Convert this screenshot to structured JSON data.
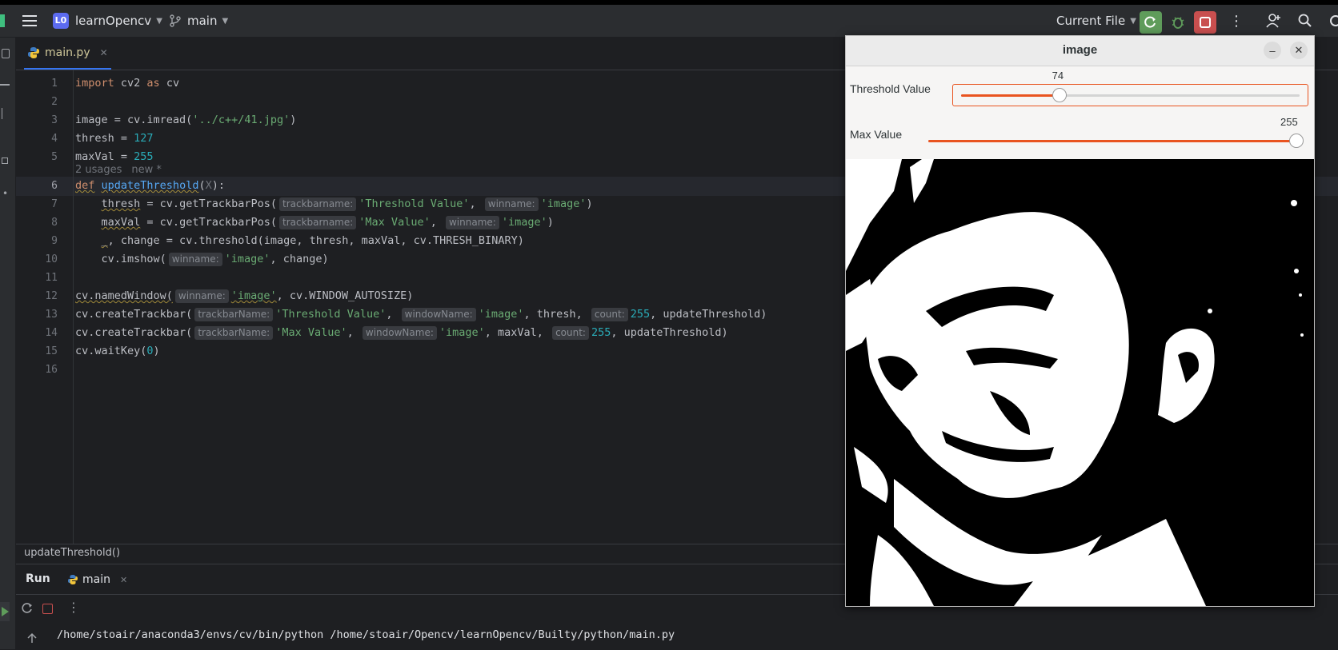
{
  "toolbar": {
    "project_badge": "L0",
    "project_name": "learnOpencv",
    "branch": "main",
    "run_config": "Current File"
  },
  "editor": {
    "tab_label": "main.py",
    "usage_hint": "2 usages",
    "usage_new": "new *",
    "line_numbers": [
      "1",
      "2",
      "3",
      "4",
      "5",
      "6",
      "7",
      "8",
      "9",
      "10",
      "11",
      "12",
      "13",
      "14",
      "15",
      "16"
    ],
    "lines": {
      "l1_import": "import",
      "l1_mod": " cv2 ",
      "l1_as": "as",
      "l1_alias": " cv",
      "l3_a": "image = cv.imread(",
      "l3_str": "'../c++/41.jpg'",
      "l3_b": ")",
      "l4_a": "thresh = ",
      "l4_num": "127",
      "l5_a": "maxVal = ",
      "l5_num": "255",
      "l6_def": "def",
      "l6_fn": "updateThreshold",
      "l6_open": "(",
      "l6_param": "X",
      "l6_close": "):",
      "l7_a": "thresh",
      "l7_b": " = cv.getTrackbarPos(",
      "l7_hint1": "trackbarname:",
      "l7_str1": "'Threshold Value'",
      "l7_comma": ",",
      "l7_hint2": "winname:",
      "l7_str2": "'image'",
      "l7_end": ")",
      "l8_a": "maxVal",
      "l8_b": " = cv.getTrackbarPos(",
      "l8_hint1": "trackbarname:",
      "l8_str1": "'Max Value'",
      "l8_comma": ",",
      "l8_hint2": "winname:",
      "l8_str2": "'image'",
      "l8_end": ")",
      "l9_a": "_",
      "l9_b": ", change = cv.threshold(image, thresh, maxVal, cv.THRESH_BINARY)",
      "l10_a": "cv.imshow(",
      "l10_hint": "winname:",
      "l10_str": "'image'",
      "l10_b": ", change)",
      "l12_a": "cv.namedWindow(",
      "l12_hint": "winname:",
      "l12_str": "'image'",
      "l12_b": ", cv.WINDOW_AUTOSIZE)",
      "l13_a": "cv.createTrackbar(",
      "l13_hint1": "trackbarName:",
      "l13_str1": "'Threshold Value'",
      "l13_comma": ",",
      "l13_hint2": "windowName:",
      "l13_str2": "'image'",
      "l13_b": ", thresh,",
      "l13_hint3": "count:",
      "l13_num": "255",
      "l13_c": ", updateThreshold)",
      "l14_a": "cv.createTrackbar(",
      "l14_hint1": "trackbarName:",
      "l14_str1": "'Max Value'",
      "l14_comma": ",",
      "l14_hint2": "windowName:",
      "l14_str2": "'image'",
      "l14_b": ", maxVal,",
      "l14_hint3": "count:",
      "l14_num": "255",
      "l14_c": ", updateThreshold)",
      "l15_a": "cv.waitKey(",
      "l15_num": "0",
      "l15_b": ")"
    }
  },
  "breadcrumb": "updateThreshold()",
  "run_panel": {
    "title": "Run",
    "tab_label": "main",
    "command": "/home/stoair/anaconda3/envs/cv/bin/python /home/stoair/Opencv/learnOpencv/Builty/python/main.py"
  },
  "cv_window": {
    "title": "image",
    "trackbars": [
      {
        "label": "Threshold Value",
        "value": "74",
        "max": 255,
        "fraction": 0.29
      },
      {
        "label": "Max Value",
        "value": "255",
        "max": 255,
        "fraction": 1.0
      }
    ]
  },
  "colors": {
    "accent": "#e95420",
    "run_green": "#5f9c5b",
    "stop_red": "#c94f4f"
  }
}
